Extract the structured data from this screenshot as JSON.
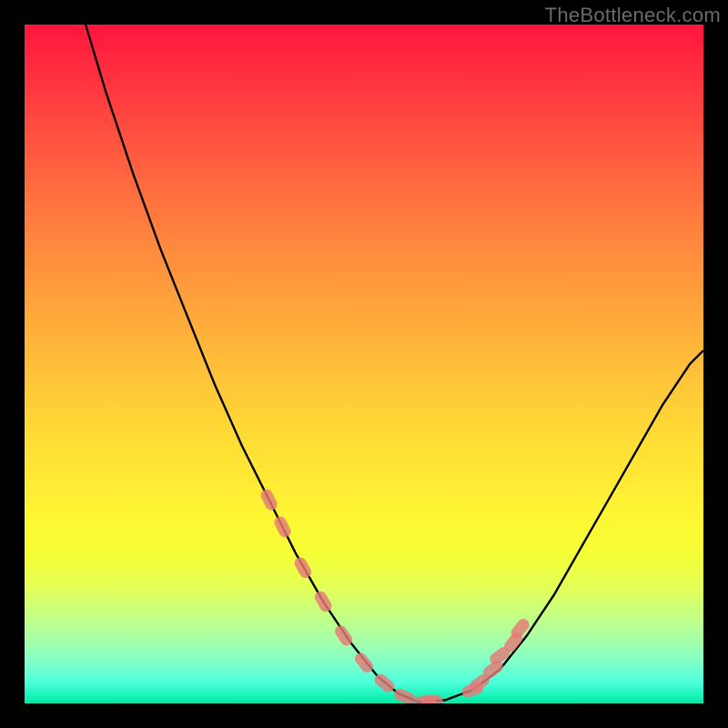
{
  "watermark": "TheBottleneck.com",
  "chart_data": {
    "type": "line",
    "title": "",
    "xlabel": "",
    "ylabel": "",
    "xlim": [
      0,
      100
    ],
    "ylim": [
      0,
      100
    ],
    "series": [
      {
        "name": "bottleneck-curve",
        "x": [
          9,
          12,
          16,
          20,
          24,
          28,
          32,
          36,
          40,
          44,
          48,
          52,
          55,
          58,
          62,
          66,
          70,
          74,
          78,
          82,
          86,
          90,
          94,
          98,
          100
        ],
        "y": [
          100,
          90,
          78,
          67,
          57,
          47,
          38,
          30,
          22,
          15,
          9,
          4,
          1.5,
          0.2,
          0.5,
          2,
          5,
          10,
          16,
          23,
          30,
          37,
          44,
          50,
          52
        ]
      }
    ],
    "markers": {
      "name": "highlighted-range",
      "x": [
        36,
        38,
        41,
        44,
        47,
        50,
        53,
        56,
        59,
        60,
        66,
        67,
        69,
        70,
        72,
        73
      ],
      "y": [
        30,
        26,
        20,
        15,
        10,
        6,
        3,
        1,
        0.3,
        0.3,
        2,
        3,
        5,
        7,
        9,
        11
      ]
    },
    "gradient_stops": [
      {
        "pos": 0,
        "color": "#ff153e"
      },
      {
        "pos": 18,
        "color": "#ff5740"
      },
      {
        "pos": 47,
        "color": "#ffb53a"
      },
      {
        "pos": 72,
        "color": "#fff533"
      },
      {
        "pos": 91,
        "color": "#a3ffab"
      },
      {
        "pos": 100,
        "color": "#0be39e"
      }
    ]
  }
}
